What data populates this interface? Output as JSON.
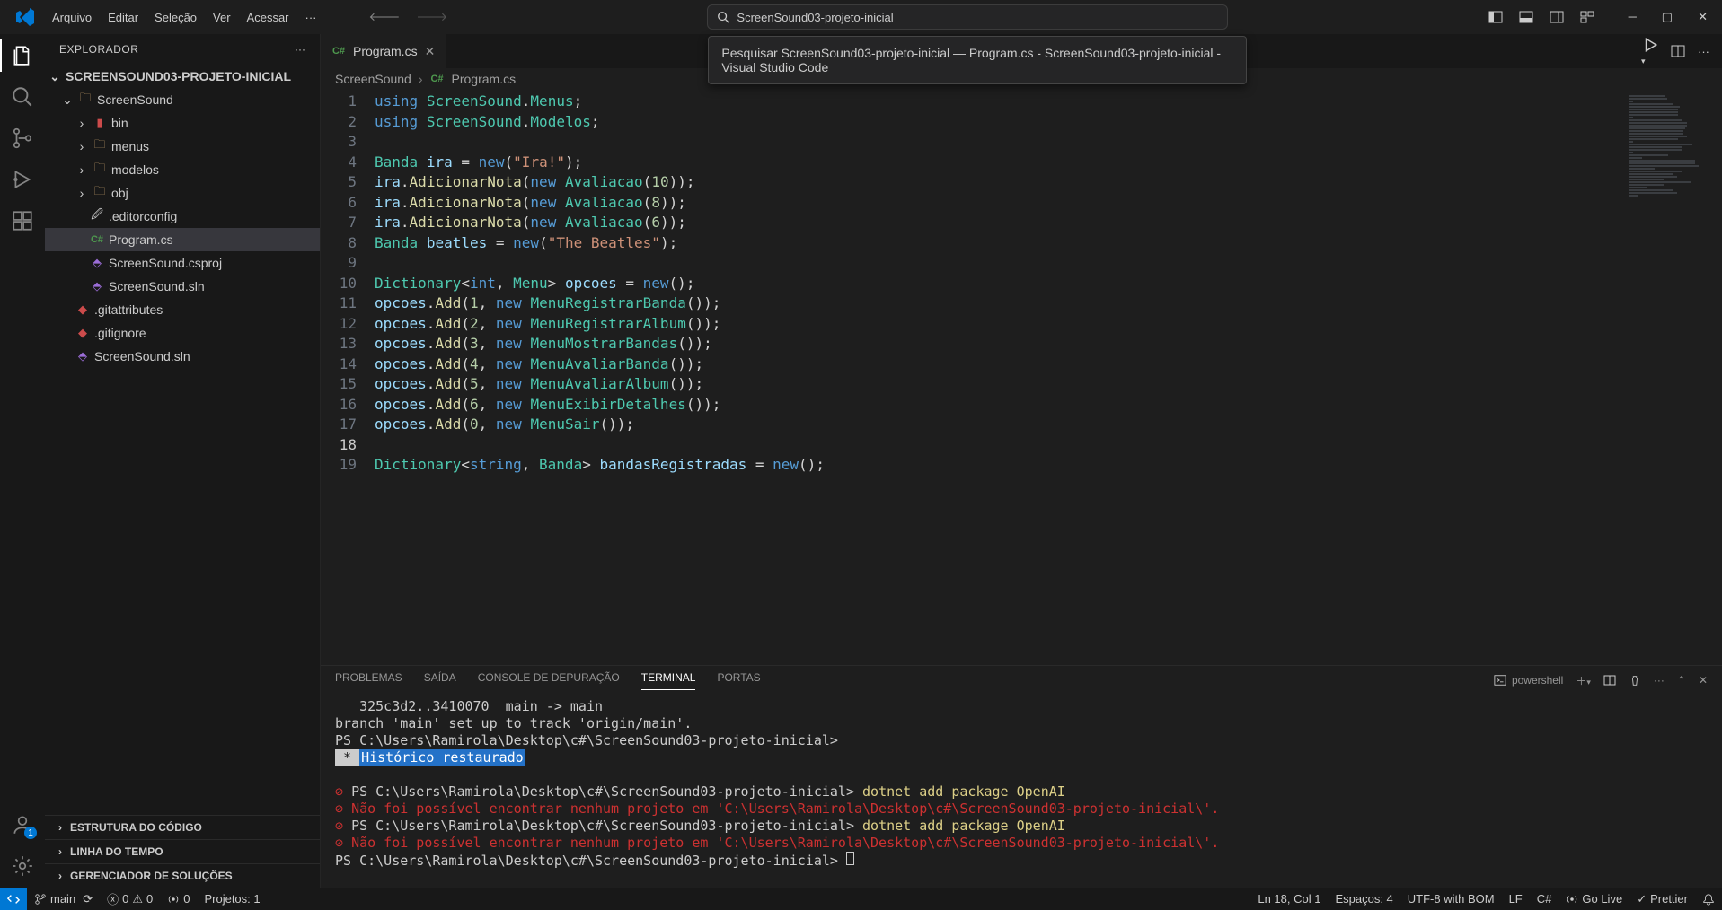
{
  "menu": {
    "arquivo": "Arquivo",
    "editar": "Editar",
    "selecao": "Seleção",
    "ver": "Ver",
    "acessar": "Acessar"
  },
  "search": {
    "text": "ScreenSound03-projeto-inicial",
    "tooltip": "Pesquisar ScreenSound03-projeto-inicial — Program.cs - ScreenSound03-projeto-inicial - Visual Studio Code"
  },
  "explorer": {
    "title": "EXPLORADOR",
    "root": "SCREENSOUND03-PROJETO-INICIAL",
    "folder_screensound": "ScreenSound",
    "bin": "bin",
    "menus": "menus",
    "modelos": "modelos",
    "obj": "obj",
    "editorconfig": ".editorconfig",
    "programcs": "Program.cs",
    "csproj": "ScreenSound.csproj",
    "sln_inner": "ScreenSound.sln",
    "gitattributes": ".gitattributes",
    "gitignore": ".gitignore",
    "sln_outer": "ScreenSound.sln",
    "sect_estrutura": "ESTRUTURA DO CÓDIGO",
    "sect_linha": "LINHA DO TEMPO",
    "sect_gerenciador": "GERENCIADOR DE SOLUÇÕES"
  },
  "tab": {
    "filename": "Program.cs",
    "lang": "C#"
  },
  "breadcrumb": {
    "a": "ScreenSound",
    "b": "Program.cs",
    "blang": "C#"
  },
  "panel": {
    "problemas": "PROBLEMAS",
    "saida": "SAÍDA",
    "console": "CONSOLE DE DEPURAÇÃO",
    "terminal": "TERMINAL",
    "portas": "PORTAS",
    "shell": "powershell"
  },
  "terminal": {
    "l1": "   325c3d2..3410070  main -> main",
    "l2": "branch 'main' set up to track 'origin/main'.",
    "l3": "PS C:\\Users\\Ramirola\\Desktop\\c#\\ScreenSound03-projeto-inicial>",
    "histlabel": " * ",
    "hist": "Histórico restaurado",
    "ps": "PS C:\\Users\\Ramirola\\Desktop\\c#\\ScreenSound03-projeto-inicial>",
    "cmd": "dotnet add package OpenAI",
    "err": "Não foi possível encontrar nenhum projeto em 'C:\\Users\\Ramirola\\Desktop\\c#\\ScreenSound03-projeto-inicial\\'."
  },
  "status": {
    "branch": "main",
    "err": "0",
    "warn": "0",
    "port": "0",
    "projetos": "Projetos: 1",
    "lncol": "Ln 18, Col 1",
    "espacos": "Espaços: 4",
    "encoding": "UTF-8 with BOM",
    "eol": "LF",
    "lang": "C#",
    "golive": "Go Live",
    "prettier": "Prettier"
  },
  "accounts_badge": "1",
  "code": {
    "lines": [
      "1",
      "2",
      "3",
      "4",
      "5",
      "6",
      "7",
      "8",
      "9",
      "10",
      "11",
      "12",
      "13",
      "14",
      "15",
      "16",
      "17",
      "18",
      "19"
    ]
  },
  "chart_data": {
    "type": "table",
    "title": "Program.cs contents",
    "lines": [
      "using ScreenSound.Menus;",
      "using ScreenSound.Modelos;",
      "",
      "Banda ira = new(\"Ira!\");",
      "ira.AdicionarNota(new Avaliacao(10));",
      "ira.AdicionarNota(new Avaliacao(8));",
      "ira.AdicionarNota(new Avaliacao(6));",
      "Banda beatles = new(\"The Beatles\");",
      "",
      "Dictionary<int, Menu> opcoes = new();",
      "opcoes.Add(1, new MenuRegistrarBanda());",
      "opcoes.Add(2, new MenuRegistrarAlbum());",
      "opcoes.Add(3, new MenuMostrarBandas());",
      "opcoes.Add(4, new MenuAvaliarBanda());",
      "opcoes.Add(5, new MenuAvaliarAlbum());",
      "opcoes.Add(6, new MenuExibirDetalhes());",
      "opcoes.Add(0, new MenuSair());",
      "",
      "Dictionary<string, Banda> bandasRegistradas = new();"
    ]
  }
}
